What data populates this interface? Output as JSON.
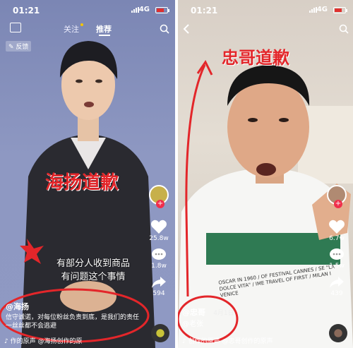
{
  "left": {
    "status": {
      "time": "01:21",
      "network": "4G"
    },
    "nav": {
      "follow": "关注",
      "recommend": "推荐"
    },
    "feedback": "反馈",
    "overlay_title": "海扬道歉",
    "subtitle_line1": "有部分人收到商品",
    "subtitle_line2": "有问题这个事情",
    "likes": "25.8w",
    "comments": "1.8w",
    "shares": "594",
    "author": "@海扬",
    "caption": "信守诚诺，对每位粉丝负责到底，是我们的责任一丝丝都不会逃避",
    "music": "作的原声  @海扬创作的原"
  },
  "right": {
    "status": {
      "time": "01:21",
      "network": "4G"
    },
    "overlay_title": "忠哥道歉",
    "likes": "6.7w",
    "comments": "1.5w",
    "shares": "439",
    "author": "@忠哥",
    "date": "4月1日",
    "tagged": "@老张",
    "music": "创作的原声  @忠哥创作的原声",
    "shirt_text": "OSCAR IN 1960 / OF FESTIVAL CANNES / SE \"LA DOLCE VITA\" / IME TRAVEL OF FIRST / MILAN I VENICE"
  },
  "colors": {
    "accent_red": "#e3262a",
    "like_red": "#f02e4b"
  }
}
